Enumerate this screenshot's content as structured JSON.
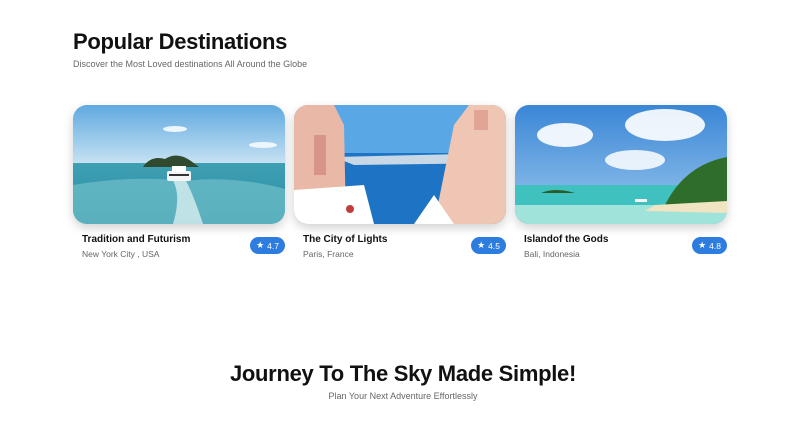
{
  "destinations": {
    "title": "Popular Destinations",
    "subtitle": "Discover the Most Loved destinations All Around the Globe",
    "cards": [
      {
        "title": "Tradition and Futurism",
        "location": "New York City , USA",
        "rating": "4.7",
        "image": "boat-island-sea-photo"
      },
      {
        "title": "The City of Lights",
        "location": "Paris, France",
        "rating": "4.5",
        "image": "whitewashed-buildings-sea-photo"
      },
      {
        "title": "Islandof the Gods",
        "location": "Bali, Indonesia",
        "rating": "4.8",
        "image": "tropical-beach-palm-photo"
      }
    ],
    "rating_icon": "star-icon",
    "rating_color": "#2d7de1"
  },
  "journey": {
    "title": "Journey To The Sky Made Simple!",
    "subtitle": "Plan Your Next Adventure Effortlessly"
  }
}
